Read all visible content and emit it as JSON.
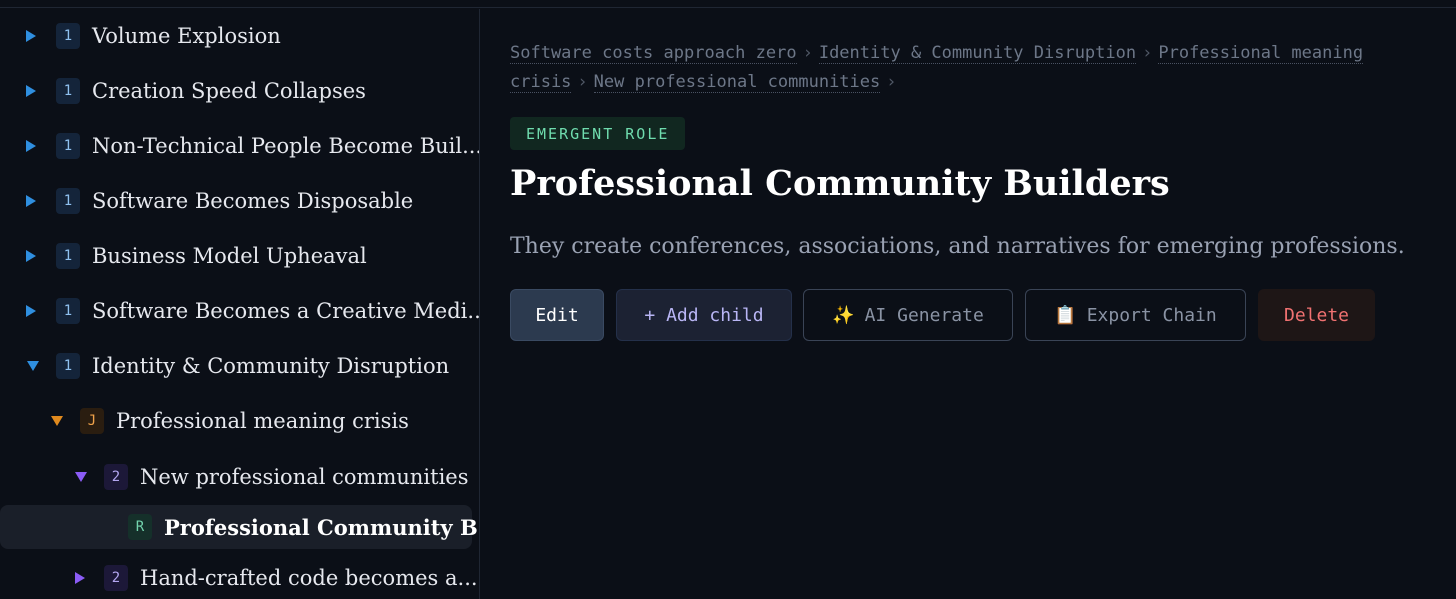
{
  "sidebar": {
    "items": [
      {
        "badge": "1",
        "label": "Volume Explosion"
      },
      {
        "badge": "1",
        "label": "Creation Speed Collapses"
      },
      {
        "badge": "1",
        "label": "Non-Technical People Become Buil..."
      },
      {
        "badge": "1",
        "label": "Software Becomes Disposable"
      },
      {
        "badge": "1",
        "label": "Business Model Upheaval"
      },
      {
        "badge": "1",
        "label": "Software Becomes a Creative Medi..."
      },
      {
        "badge": "1",
        "label": "Identity & Community Disruption"
      },
      {
        "badge": "J",
        "label": "Professional meaning crisis"
      },
      {
        "badge": "2",
        "label": "New professional communities"
      },
      {
        "badge": "R",
        "label": "Professional Community B..."
      },
      {
        "badge": "2",
        "label": "Hand-crafted code becomes a..."
      }
    ]
  },
  "breadcrumb": [
    "Software costs approach zero",
    "Identity & Community Disruption",
    "Professional meaning crisis",
    "New professional communities"
  ],
  "breadcrumb_separator": "›",
  "node": {
    "type_badge": "EMERGENT ROLE",
    "title": "Professional Community Builders",
    "description": "They create conferences, associations, and narratives for emerging professions."
  },
  "actions": {
    "edit": "Edit",
    "add_child": "+ Add child",
    "ai_generate": "AI Generate",
    "ai_icon": "✨",
    "export_chain": "Export Chain",
    "export_icon": "📋",
    "delete": "Delete"
  },
  "colors": {
    "background": "#0b0f17",
    "accent_blue": "#2f8fe0",
    "accent_orange": "#e08a1e",
    "accent_purple": "#8b5cf6",
    "role_green": "#6fdcae",
    "delete_red": "#f07171"
  }
}
